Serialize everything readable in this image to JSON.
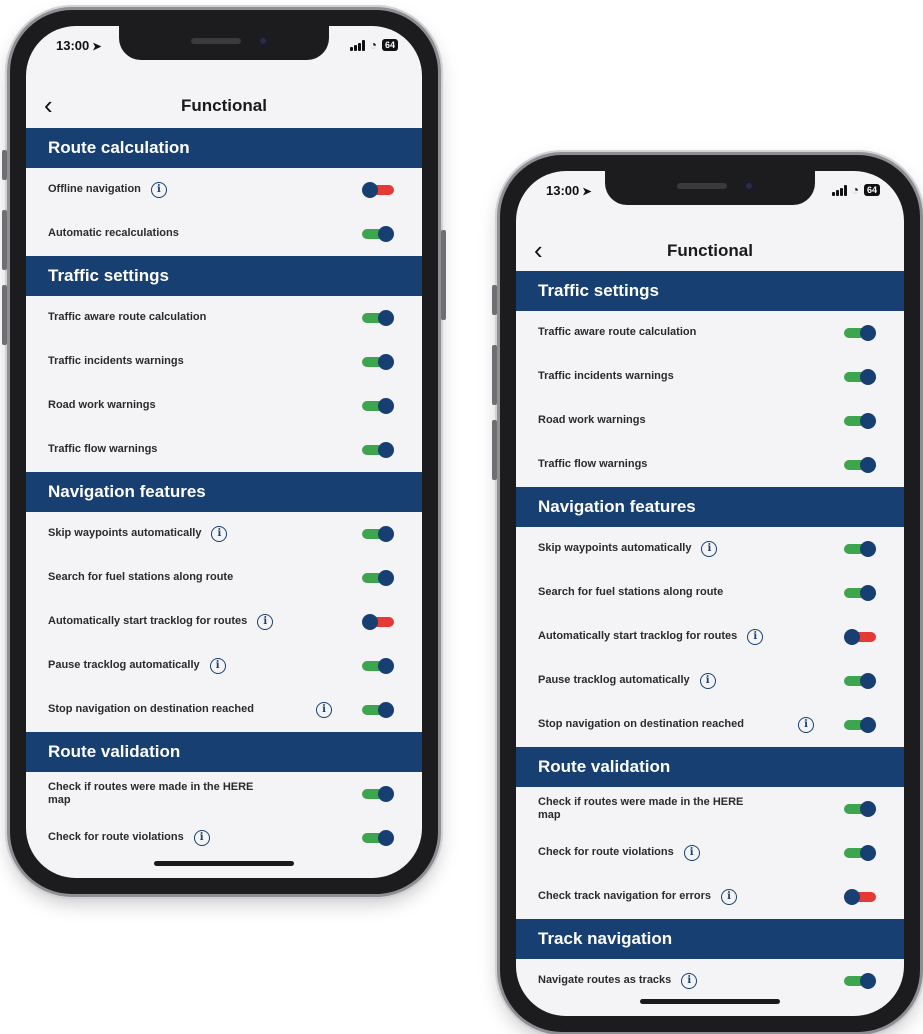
{
  "left_phone": {
    "status": {
      "time": "13:00",
      "battery": "64"
    },
    "nav": {
      "title": "Functional"
    },
    "sections": [
      {
        "header": "Route calculation",
        "rows": [
          {
            "label": "Offline navigation",
            "info": true,
            "on": false
          },
          {
            "label": "Automatic recalculations",
            "info": false,
            "on": true
          }
        ]
      },
      {
        "header": "Traffic settings",
        "rows": [
          {
            "label": "Traffic aware route calculation",
            "info": false,
            "on": true
          },
          {
            "label": "Traffic incidents warnings",
            "info": false,
            "on": true
          },
          {
            "label": "Road work warnings",
            "info": false,
            "on": true
          },
          {
            "label": "Traffic flow warnings",
            "info": false,
            "on": true
          }
        ]
      },
      {
        "header": "Navigation features",
        "rows": [
          {
            "label": "Skip waypoints automatically",
            "info": true,
            "on": true
          },
          {
            "label": "Search for fuel stations along route",
            "info": false,
            "on": true
          },
          {
            "label": "Automatically start tracklog for routes",
            "info": true,
            "on": false
          },
          {
            "label": "Pause tracklog automatically",
            "info": true,
            "on": true
          },
          {
            "label": "Stop navigation on destination reached",
            "info": true,
            "on": true,
            "two_line": true
          }
        ]
      },
      {
        "header": "Route validation",
        "rows": [
          {
            "label": "Check if routes were made in the HERE map",
            "info": false,
            "on": true,
            "two_line": true
          },
          {
            "label": "Check for route violations",
            "info": true,
            "on": true
          }
        ]
      }
    ]
  },
  "right_phone": {
    "status": {
      "time": "13:00",
      "battery": "64"
    },
    "nav": {
      "title": "Functional"
    },
    "sections": [
      {
        "header": "Traffic settings",
        "rows": [
          {
            "label": "Traffic aware route calculation",
            "info": false,
            "on": true
          },
          {
            "label": "Traffic incidents warnings",
            "info": false,
            "on": true
          },
          {
            "label": "Road work warnings",
            "info": false,
            "on": true
          },
          {
            "label": "Traffic flow warnings",
            "info": false,
            "on": true
          }
        ]
      },
      {
        "header": "Navigation features",
        "rows": [
          {
            "label": "Skip waypoints automatically",
            "info": true,
            "on": true
          },
          {
            "label": "Search for fuel stations along route",
            "info": false,
            "on": true
          },
          {
            "label": "Automatically start tracklog for routes",
            "info": true,
            "on": false
          },
          {
            "label": "Pause tracklog automatically",
            "info": true,
            "on": true
          },
          {
            "label": "Stop navigation on destination reached",
            "info": true,
            "on": true,
            "two_line": true
          }
        ]
      },
      {
        "header": "Route validation",
        "rows": [
          {
            "label": "Check if routes were made in the HERE map",
            "info": false,
            "on": true,
            "two_line": true
          },
          {
            "label": "Check for route violations",
            "info": true,
            "on": true
          },
          {
            "label": "Check track navigation for errors",
            "info": true,
            "on": false
          }
        ]
      },
      {
        "header": "Track navigation",
        "rows": [
          {
            "label": "Navigate routes as tracks",
            "info": true,
            "on": true
          }
        ]
      }
    ]
  },
  "icons": {
    "info": "info-circle-icon",
    "back": "chevron-left-icon",
    "location": "location-arrow-icon",
    "signal": "cellular-signal-icon",
    "wifi": "wifi-icon",
    "battery": "battery-icon"
  },
  "colors": {
    "section_header": "#173f72",
    "toggle_on": "#3da54e",
    "toggle_off": "#e53935",
    "knob": "#173f72",
    "screen_bg": "#f4f4f6"
  }
}
